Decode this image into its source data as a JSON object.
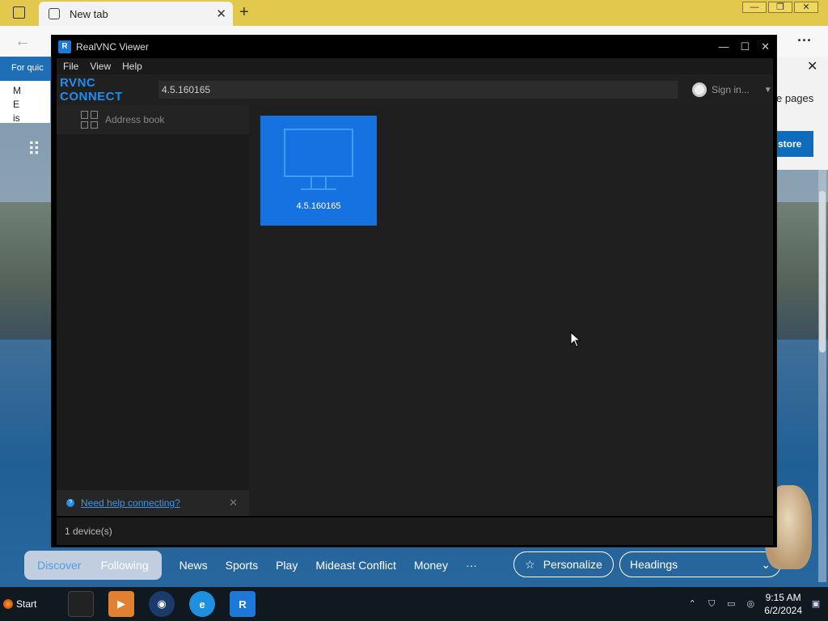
{
  "browser": {
    "tab_label": "New tab",
    "tab_close": "✕",
    "new_tab": "+",
    "back": "←",
    "more": "···",
    "quick_links": "For quic",
    "left_panel_lines": [
      "M",
      "E",
      "is"
    ],
    "popup_close": "✕",
    "popup_text": "e pages",
    "restore_label": "store",
    "window_controls": [
      "—",
      "❐",
      "✕"
    ]
  },
  "vnc": {
    "app_icon": "R",
    "title": "RealVNC Viewer",
    "window_controls": [
      "—",
      "☐",
      "✕"
    ],
    "menu": [
      "File",
      "View",
      "Help"
    ],
    "logo": "RVNC CONNECT",
    "address_value": "4.5.160165",
    "sign_in": "Sign in...",
    "sidebar_item": "Address book",
    "help_link": "Need help connecting?",
    "help_close": "✕",
    "device_label": "4.5.160165",
    "status": "1 device(s)"
  },
  "news_bar": {
    "pills": [
      {
        "label": "Discover",
        "active": true
      },
      {
        "label": "Following",
        "active": false
      }
    ],
    "links": [
      "News",
      "Sports",
      "Play",
      "Mideast Conflict",
      "Money",
      "···"
    ],
    "personalize": "Personalize",
    "headings": "Headings"
  },
  "taskbar": {
    "start": "Start",
    "vnc_icon": "R",
    "time": "9:15 AM",
    "date": "6/2/2024"
  },
  "colors": {
    "vnc_accent": "#1f8ef2",
    "device_tile": "#1672e0",
    "browser_tabbar": "#e2c84c"
  }
}
